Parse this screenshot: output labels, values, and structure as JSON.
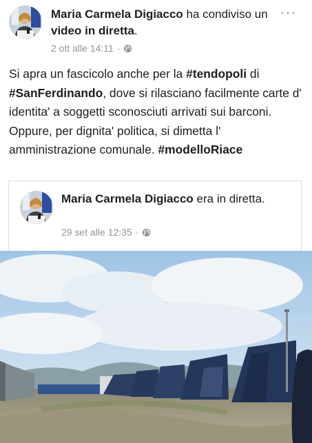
{
  "post": {
    "author": "Maria Carmela Digiacco",
    "action_prefix": " ha condiviso un ",
    "action_object": "video in diretta",
    "action_suffix": ".",
    "timestamp": "2 ott alle 14:11",
    "separator": "·",
    "privacy_icon": "globe-icon",
    "more_icon": "more-options-icon",
    "more_label": "···",
    "text": {
      "part1": "Si apra un fascicolo anche per la ",
      "tag1": "#tendopoli",
      "part2": " di ",
      "tag2": "#SanFerdinando",
      "part3": ", dove si rilasciano facilmente carte d' identita' a soggetti sconosciuti arrivati sui barconi. Oppure, per dignita' politica, si dimetta l' amministrazione comunale. ",
      "tag3": "#modelloRiace"
    }
  },
  "shared": {
    "author": "Maria Carmela Digiacco",
    "action": " era in diretta.",
    "timestamp": "29 set alle 12:35",
    "separator": "·",
    "privacy_icon": "globe-icon"
  },
  "colors": {
    "text": "#1c1e21",
    "meta": "#90949c",
    "border": "#dddfe2"
  }
}
